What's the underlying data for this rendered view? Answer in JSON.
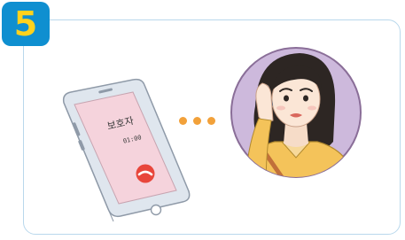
{
  "step": {
    "number": "5"
  },
  "phone": {
    "caller_name": "보호자",
    "call_time": "01:00"
  },
  "colors": {
    "card_border": "#b9d8ec",
    "badge_bg": "#0f8fd0",
    "badge_text": "#ffd21c",
    "phone_screen": "#f5d3dc",
    "end_call": "#e8463b",
    "portrait_bg": "#cdb9dc",
    "dots": "#f2a13a"
  },
  "icons": [
    "smartphone-icon",
    "end-call-icon",
    "ellipsis-icon",
    "worried-woman-on-phone-illustration"
  ]
}
